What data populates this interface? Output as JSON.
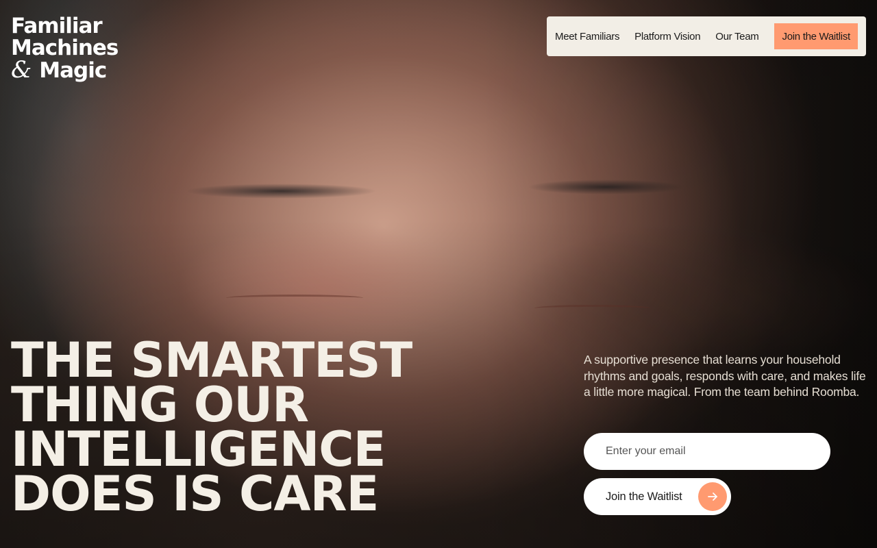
{
  "brand": {
    "line1": "Familiar",
    "line2": "Machines",
    "ampersand": "&",
    "line3": "Magic"
  },
  "nav": {
    "items": [
      {
        "label": "Meet Familiars"
      },
      {
        "label": "Platform Vision"
      },
      {
        "label": "Our Team"
      }
    ],
    "cta_label": "Join the Waitlist"
  },
  "hero": {
    "headline_lines": [
      "THE SMARTEST",
      "THING OUR",
      "INTELLIGENCE",
      "DOES IS CARE"
    ],
    "tagline": "A supportive presence that learns your household rhythms and goals, responds with care, and makes life a little more magical. From the team behind Roomba.",
    "email_placeholder": "Enter your email",
    "submit_label": "Join the Waitlist",
    "submit_icon": "arrow-right-icon"
  },
  "colors": {
    "accent": "#ff9a70",
    "nav_background": "#f2eee6",
    "headline_text": "#f4efe6"
  }
}
